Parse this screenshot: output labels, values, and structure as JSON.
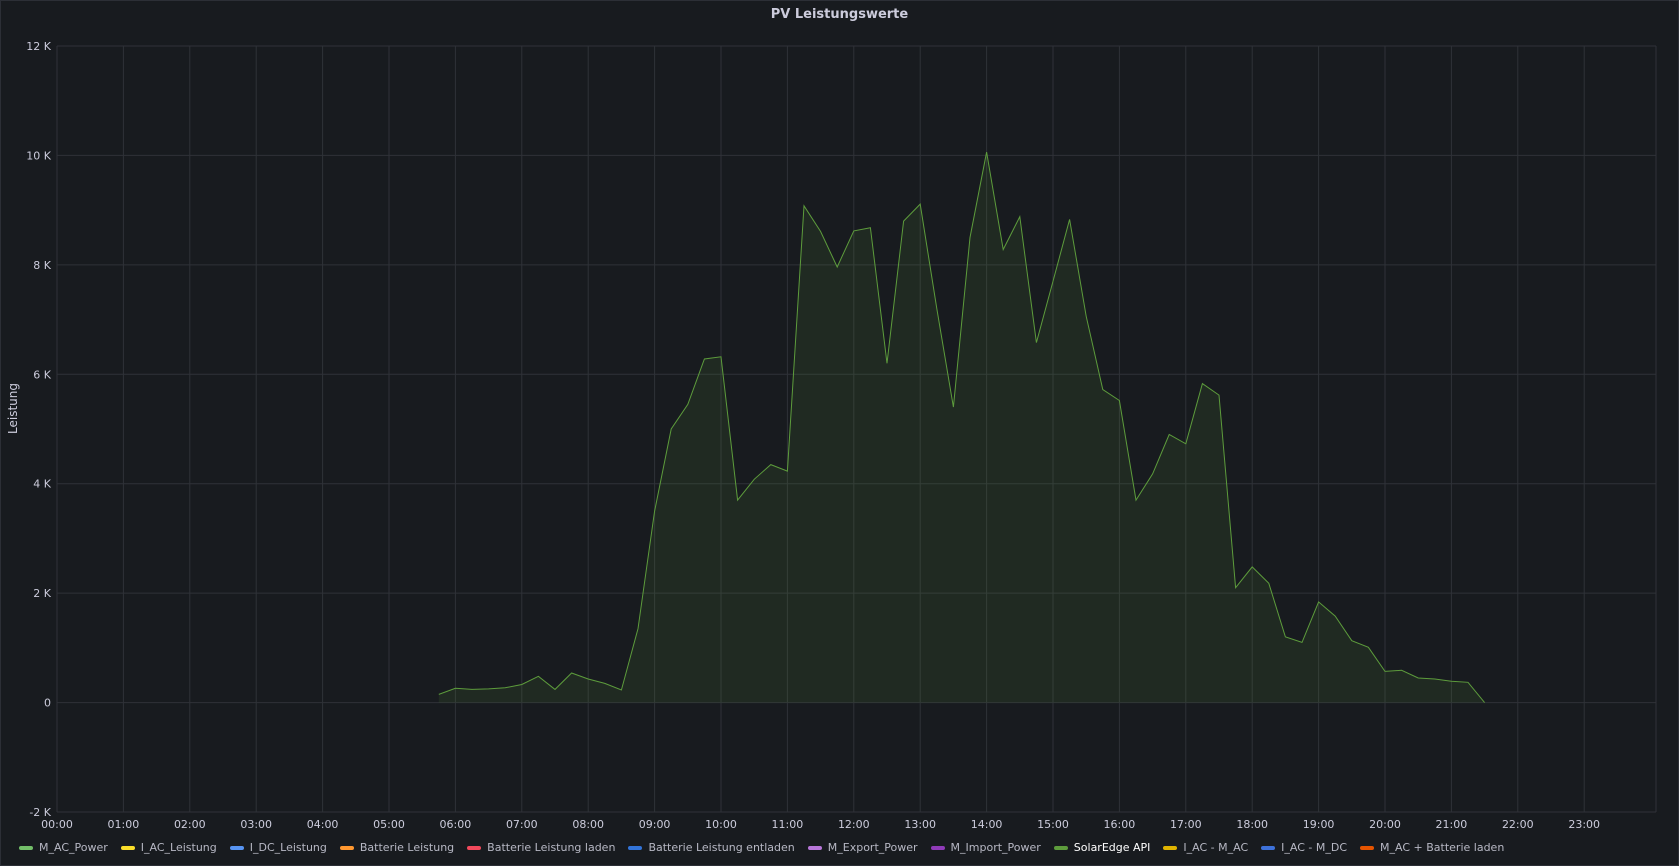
{
  "panel": {
    "title": "PV Leistungswerte"
  },
  "chart_data": {
    "type": "area",
    "title": "PV Leistungswerte",
    "ylabel": "Leistung",
    "xlabel": "",
    "ylim": [
      -2000,
      12000
    ],
    "y_ticks": [
      -2000,
      0,
      2000,
      4000,
      6000,
      8000,
      10000,
      12000
    ],
    "y_tick_labels": [
      "-2 K",
      "0",
      "2 K",
      "4 K",
      "6 K",
      "8 K",
      "10 K",
      "12 K"
    ],
    "x_range_hours": [
      0,
      24
    ],
    "x_tick_labels": [
      "00:00",
      "01:00",
      "02:00",
      "03:00",
      "04:00",
      "05:00",
      "06:00",
      "07:00",
      "08:00",
      "09:00",
      "10:00",
      "11:00",
      "12:00",
      "13:00",
      "14:00",
      "15:00",
      "16:00",
      "17:00",
      "18:00",
      "19:00",
      "20:00",
      "21:00",
      "22:00",
      "23:00"
    ],
    "grid": true,
    "legend_position": "bottom",
    "series": [
      {
        "name": "SolarEdge API",
        "color": "#5d9c3c",
        "x": [
          "05:45",
          "06:00",
          "06:15",
          "06:30",
          "06:45",
          "07:00",
          "07:15",
          "07:30",
          "07:45",
          "08:00",
          "08:15",
          "08:30",
          "08:45",
          "09:00",
          "09:15",
          "09:30",
          "09:45",
          "10:00",
          "10:15",
          "10:30",
          "10:45",
          "11:00",
          "11:15",
          "11:30",
          "11:45",
          "12:00",
          "12:15",
          "12:30",
          "12:45",
          "13:00",
          "13:15",
          "13:30",
          "13:45",
          "14:00",
          "14:15",
          "14:30",
          "14:45",
          "15:00",
          "15:15",
          "15:30",
          "15:45",
          "16:00",
          "16:15",
          "16:30",
          "16:45",
          "17:00",
          "17:15",
          "17:30",
          "17:45",
          "18:00",
          "18:15",
          "18:30",
          "18:45",
          "19:00",
          "19:15",
          "19:30",
          "19:45",
          "20:00",
          "20:15",
          "20:30",
          "20:45",
          "21:00",
          "21:15",
          "21:30"
        ],
        "values": [
          150,
          260,
          240,
          250,
          270,
          330,
          480,
          240,
          540,
          430,
          350,
          230,
          1350,
          3500,
          5000,
          5450,
          6280,
          6320,
          3700,
          4080,
          4350,
          4230,
          9080,
          8610,
          7960,
          8620,
          8680,
          6200,
          8800,
          9110,
          7200,
          5400,
          8500,
          10060,
          8280,
          8880,
          6580,
          7700,
          8830,
          7060,
          5720,
          5520,
          3700,
          4180,
          4900,
          4730,
          5830,
          5620,
          2100,
          2480,
          2180,
          1200,
          1100,
          1840,
          1580,
          1130,
          1010,
          570,
          590,
          450,
          430,
          390,
          370,
          0
        ]
      }
    ],
    "legend": [
      {
        "name": "M_AC_Power",
        "color": "#73bf69"
      },
      {
        "name": "I_AC_Leistung",
        "color": "#fade2a"
      },
      {
        "name": "I_DC_Leistung",
        "color": "#5794f2"
      },
      {
        "name": "Batterie Leistung",
        "color": "#ff9830"
      },
      {
        "name": "Batterie Leistung laden",
        "color": "#f2495c"
      },
      {
        "name": "Batterie Leistung entladen",
        "color": "#3274d9"
      },
      {
        "name": "M_Export_Power",
        "color": "#b877d9"
      },
      {
        "name": "M_Import_Power",
        "color": "#8f3bb8"
      },
      {
        "name": "SolarEdge API",
        "color": "#5d9c3c"
      },
      {
        "name": "I_AC - M_AC",
        "color": "#e0b400"
      },
      {
        "name": "I_AC - M_DC",
        "color": "#3d71d9"
      },
      {
        "name": "M_AC + Batterie laden",
        "color": "#e55400"
      }
    ]
  }
}
